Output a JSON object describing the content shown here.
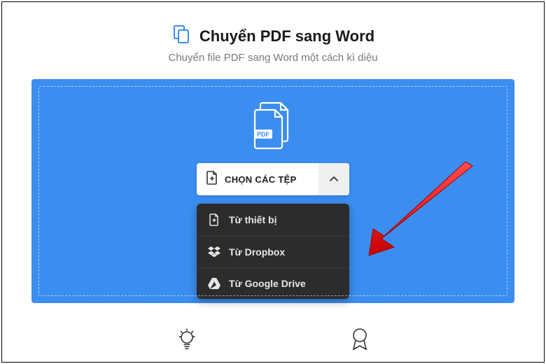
{
  "header": {
    "title": "Chuyển PDF sang Word",
    "subtitle": "Chuyển file PDF sang Word một cách kì diệu"
  },
  "upload": {
    "button_label": "CHỌN CÁC TỆP",
    "pdf_badge": "PDF",
    "options": [
      {
        "label": "Từ thiết bị"
      },
      {
        "label": "Từ Dropbox"
      },
      {
        "label": "Từ Google Drive"
      }
    ]
  }
}
